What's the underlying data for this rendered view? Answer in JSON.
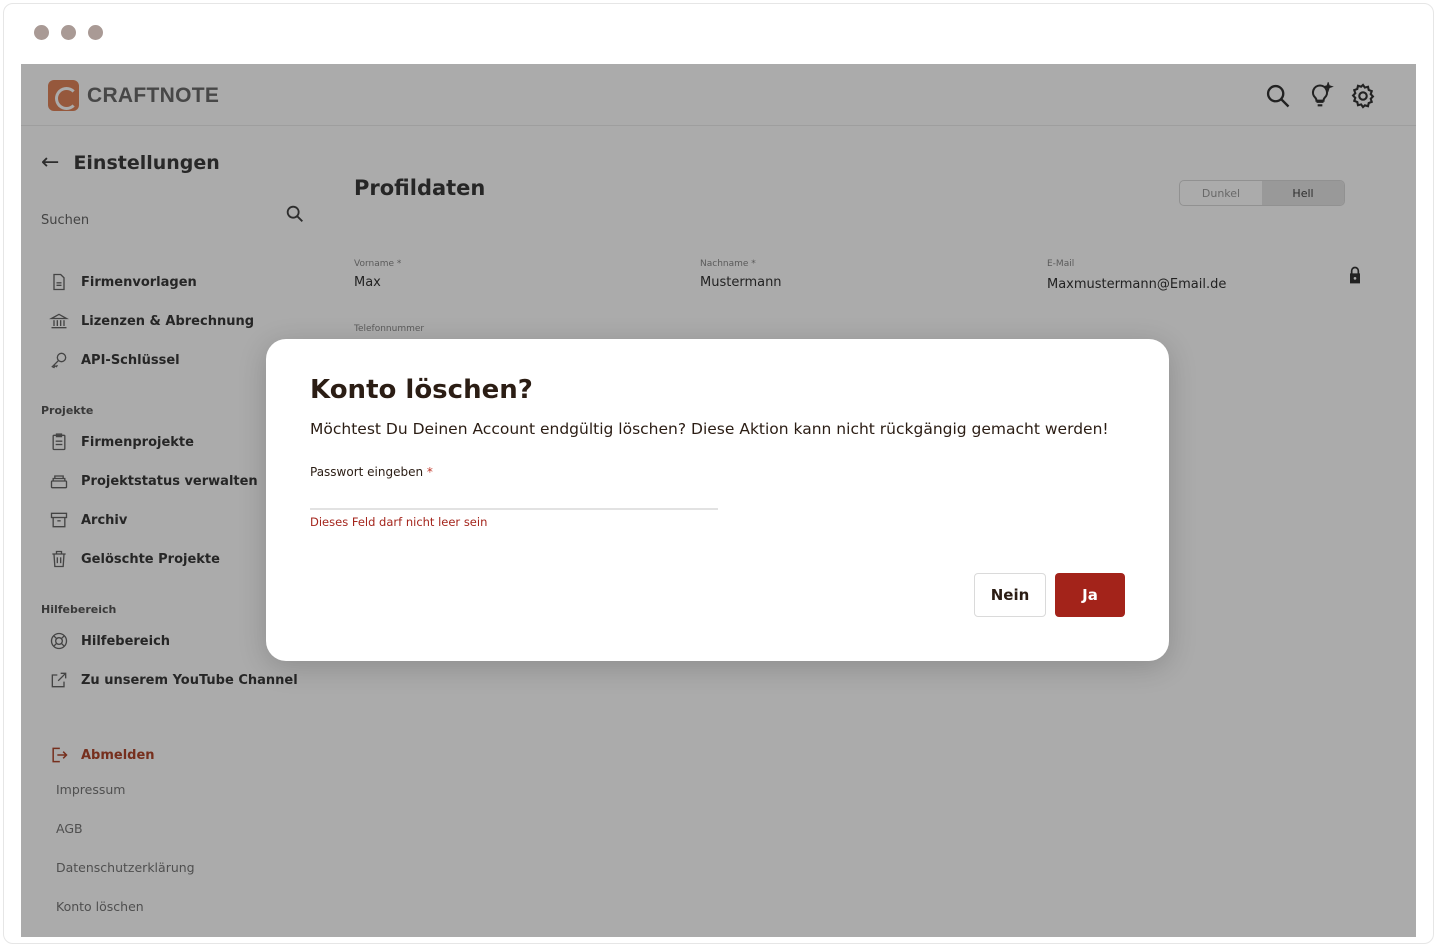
{
  "header": {
    "logo_text": "CRAFTNOTE",
    "icons": [
      "search-icon",
      "lightbulb-icon",
      "gear-icon"
    ]
  },
  "sidebar": {
    "title": "Einstellungen",
    "search_label": "Suchen",
    "items_top": [
      {
        "label": "Firmenvorlagen",
        "icon": "document-icon"
      },
      {
        "label": "Lizenzen & Abrechnung",
        "icon": "bank-icon"
      },
      {
        "label": "API-Schlüssel",
        "icon": "key-icon"
      }
    ],
    "section_projects": "Projekte",
    "items_projects": [
      {
        "label": "Firmenprojekte",
        "icon": "clipboard-icon"
      },
      {
        "label": "Projektstatus verwalten",
        "icon": "stack-icon"
      },
      {
        "label": "Archiv",
        "icon": "archive-icon"
      },
      {
        "label": "Gelöschte Projekte",
        "icon": "trash-icon"
      }
    ],
    "section_help": "Hilfebereich",
    "items_help": [
      {
        "label": "Hilfebereich",
        "icon": "lifebuoy-icon"
      },
      {
        "label": "Zu unserem YouTube Channel",
        "icon": "external-link-icon"
      }
    ],
    "logout": "Abmelden",
    "footer_links": [
      "Impressum",
      "AGB",
      "Datenschutzerklärung",
      "Konto löschen"
    ]
  },
  "main": {
    "title": "Profildaten",
    "theme_toggle": {
      "options": [
        "Dunkel",
        "Hell"
      ],
      "selected": "Hell"
    },
    "fields": {
      "firstname": {
        "label": "Vorname *",
        "value": "Max"
      },
      "lastname": {
        "label": "Nachname *",
        "value": "Mustermann"
      },
      "email": {
        "label": "E-Mail",
        "value": "Maxmustermann@Email.de"
      },
      "phone": {
        "label": "Telefonnummer",
        "value": ""
      }
    }
  },
  "modal": {
    "title": "Konto löschen?",
    "message": "Möchtest Du Deinen Account endgültig löschen? Diese Aktion kann nicht rückgängig gemacht werden!",
    "password_label": "Passwort eingeben",
    "required_mark": "*",
    "password_value": "",
    "error": "Dieses Feld darf nicht leer sein",
    "btn_no": "Nein",
    "btn_yes": "Ja"
  },
  "colors": {
    "accent": "#a3231a",
    "brand": "#e0835a",
    "error": "#a4251c"
  }
}
